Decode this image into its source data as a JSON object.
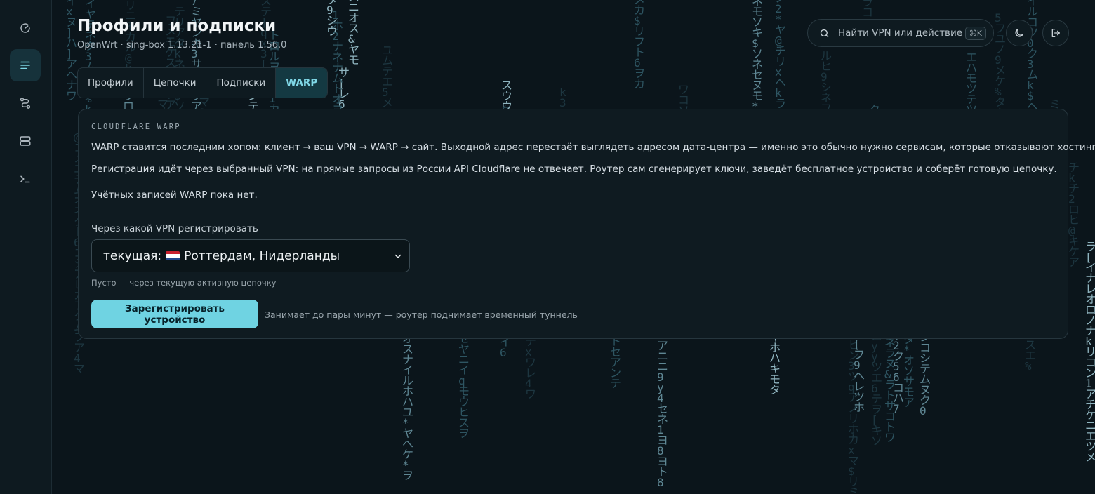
{
  "header": {
    "title": "Профили и подписки",
    "subtitle": "OpenWrt · sing-box 1.13.21-1 · панель 1.56.0"
  },
  "tabs": [
    {
      "label": "Профили",
      "active": false
    },
    {
      "label": "Цепочки",
      "active": false
    },
    {
      "label": "Подписки",
      "active": false
    },
    {
      "label": "WARP",
      "active": true
    }
  ],
  "search": {
    "placeholder": "Найти VPN или действие",
    "shortcut": "⌘K"
  },
  "sidebar": {
    "items": [
      {
        "icon": "dashboard-icon",
        "active": false
      },
      {
        "icon": "list-icon",
        "active": true
      },
      {
        "icon": "routes-icon",
        "active": false
      },
      {
        "icon": "servers-icon",
        "active": false
      },
      {
        "icon": "terminal-icon",
        "active": false
      }
    ]
  },
  "toolbar": {
    "theme_icon": "moon-icon",
    "logout_icon": "logout-icon"
  },
  "card": {
    "label": "CLOUDFLARE WARP",
    "paragraph1": "WARP ставится последним хопом: клиент → ваш VPN → WARP → сайт. Выходной адрес перестаёт выглядеть адресом дата-центра — именно это обычно нужно сервисам, которые отказывают хостингам.",
    "paragraph2": "Регистрация идёт через выбранный VPN: на прямые запросы из России API Cloudflare не отвечает. Роутер сам сгенерирует ключи, заведёт бесплатное устройство и соберёт готовую цепочку.",
    "empty_state": "Учётных записей WARP пока нет.",
    "field_label": "Через какой VPN регистрировать",
    "select_prefix": "текущая:",
    "select_location": "Роттердам, Нидерланды",
    "hint": "Пусто — через текущую активную цепочку",
    "button_label": "Зарегистрировать устройство",
    "button_note": "Занимает до пары минут — роутер поднимает временный туннель"
  },
  "colors": {
    "accent": "#6fd3e2",
    "background": "#0b151b",
    "card": "#0f1b21"
  }
}
